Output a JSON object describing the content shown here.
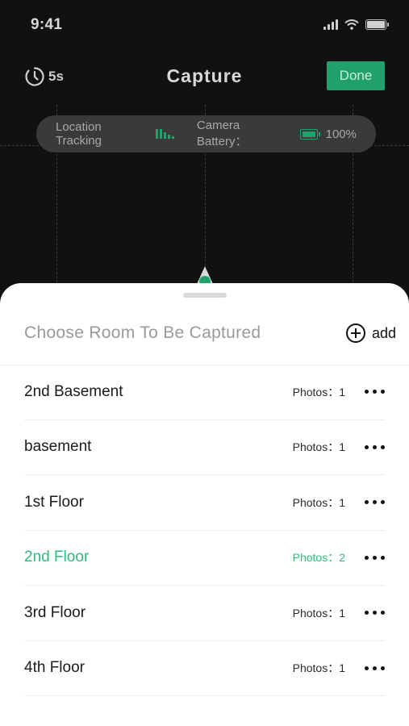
{
  "status_bar": {
    "time": "9:41"
  },
  "header": {
    "timer_label": "5s",
    "title": "Capture",
    "done_label": "Done"
  },
  "info": {
    "location_label": "Location Tracking",
    "camera_label": "Camera Battery：",
    "camera_value": "100%"
  },
  "sheet": {
    "title": "Choose Room To Be Captured",
    "add_label": "add",
    "rooms": [
      {
        "name": "2nd Basement",
        "photos": "Photos：1",
        "active": false
      },
      {
        "name": "basement",
        "photos": "Photos：1",
        "active": false
      },
      {
        "name": "1st Floor",
        "photos": "Photos：1",
        "active": false
      },
      {
        "name": "2nd Floor",
        "photos": "Photos：2",
        "active": true
      },
      {
        "name": "3rd Floor",
        "photos": "Photos：1",
        "active": false
      },
      {
        "name": "4th Floor",
        "photos": "Photos：1",
        "active": false
      }
    ]
  },
  "colors": {
    "accent": "#1fa36c",
    "active_text": "#2dbb7e",
    "background": "#111111",
    "sheet": "#ffffff"
  },
  "icons": {
    "status": [
      "signal-icon",
      "wifi-icon",
      "battery-icon"
    ],
    "timer": "timer-icon",
    "tracking": "tracking-bars-icon",
    "camera_battery": "camera-battery-icon",
    "add": "add-circle-icon",
    "more": "more-icon"
  }
}
